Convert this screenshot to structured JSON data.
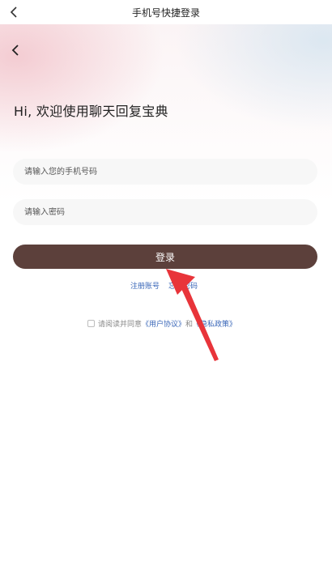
{
  "header": {
    "title": "手机号快捷登录",
    "back_icon": "chevron-left-icon"
  },
  "hero": {
    "back_icon": "chevron-left-icon",
    "welcome": "Hi, 欢迎使用聊天回复宝典"
  },
  "form": {
    "phone_placeholder": "请输入您的手机号码",
    "phone_value": "",
    "password_placeholder": "请输入密码",
    "password_value": "",
    "login_label": "登录"
  },
  "links": {
    "register": "注册账号",
    "forgot": "忘记密码"
  },
  "agreement": {
    "checked": false,
    "prefix": "请阅读并同意",
    "user_agreement": "《用户协议》",
    "and": "和",
    "privacy_policy": "《隐私政策》"
  },
  "annotation": {
    "color": "#e8343a"
  }
}
